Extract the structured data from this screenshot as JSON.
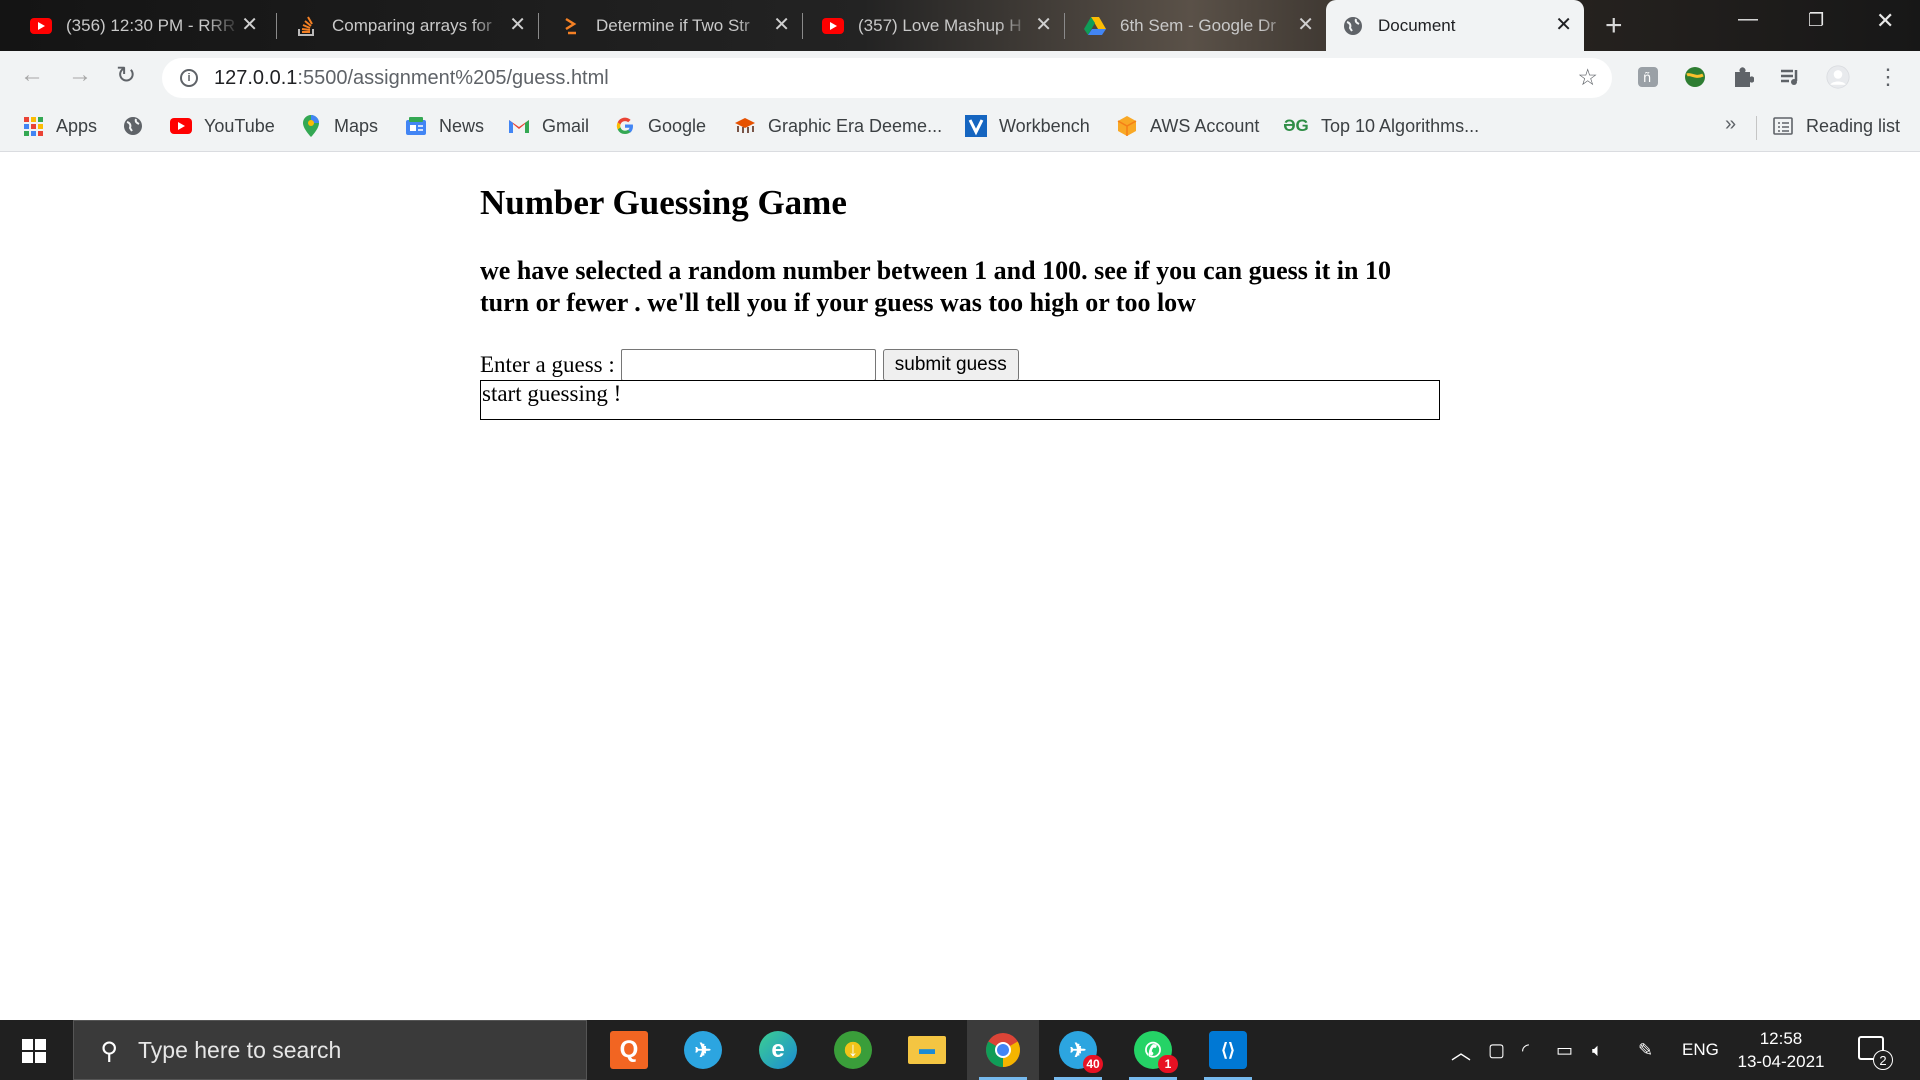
{
  "browser": {
    "tabs": [
      {
        "title": "(356) 12:30 PM - RRR",
        "icon": "youtube-icon",
        "active": false
      },
      {
        "title": "Comparing arrays for",
        "icon": "stackoverflow-icon",
        "active": false
      },
      {
        "title": "Determine if Two Str",
        "icon": "stackexchange-icon",
        "active": false
      },
      {
        "title": "(357) Love Mashup H",
        "icon": "youtube-icon",
        "active": false
      },
      {
        "title": "6th Sem - Google Dr",
        "icon": "google-drive-icon",
        "active": false
      },
      {
        "title": "Document",
        "icon": "globe-icon",
        "active": true
      }
    ],
    "address": {
      "host": "127.0.0.1",
      "path": ":5500/assignment%205/guess.html"
    },
    "bookmarks": [
      {
        "label": "Apps",
        "icon": "apps-grid-icon"
      },
      {
        "label": "",
        "icon": "globe-icon"
      },
      {
        "label": "YouTube",
        "icon": "youtube-icon"
      },
      {
        "label": "Maps",
        "icon": "maps-pin-icon"
      },
      {
        "label": "News",
        "icon": "news-icon"
      },
      {
        "label": "Gmail",
        "icon": "gmail-icon"
      },
      {
        "label": "Google",
        "icon": "google-icon"
      },
      {
        "label": "Graphic Era Deeme...",
        "icon": "university-icon"
      },
      {
        "label": "Workbench",
        "icon": "workbench-icon"
      },
      {
        "label": "AWS Account",
        "icon": "aws-box-icon"
      },
      {
        "label": "Top 10 Algorithms...",
        "icon": "geeksforgeeks-icon"
      }
    ],
    "bookmarks_overflow": "»",
    "reading_list": "Reading list"
  },
  "page": {
    "heading": "Number Guessing Game",
    "intro": "we have selected a random number between 1 and 100. see if you can guess it in 10 turn or fewer . we'll tell you if your guess was too high or too low",
    "guess_label": "Enter a guess :",
    "guess_value": "",
    "submit_label": "submit guess",
    "result_text": "start guessing !"
  },
  "taskbar": {
    "search_placeholder": "Type here to search",
    "apps": [
      {
        "name": "qnotes",
        "label": "Q",
        "color": "#f26522"
      },
      {
        "name": "telegram",
        "label": "✈",
        "color": "#2ca5e0"
      },
      {
        "name": "edge",
        "label": "e",
        "color": "#1b8bd4"
      },
      {
        "name": "internet-download-manager",
        "label": "↓",
        "color": "#3a9e3a"
      },
      {
        "name": "file-explorer",
        "label": "▬",
        "color": "#f4c542"
      },
      {
        "name": "chrome",
        "label": "",
        "color": "#ffffff"
      },
      {
        "name": "telegram-desktop",
        "label": "✈",
        "color": "#2ca5e0",
        "badge": "40"
      },
      {
        "name": "whatsapp",
        "label": "✆",
        "color": "#25d366",
        "badge": "1"
      },
      {
        "name": "vscode",
        "label": "⟨⟩",
        "color": "#0078d4"
      }
    ],
    "tray": {
      "language": "ENG",
      "time": "12:58",
      "date": "13-04-2021",
      "notifications": "2"
    }
  }
}
